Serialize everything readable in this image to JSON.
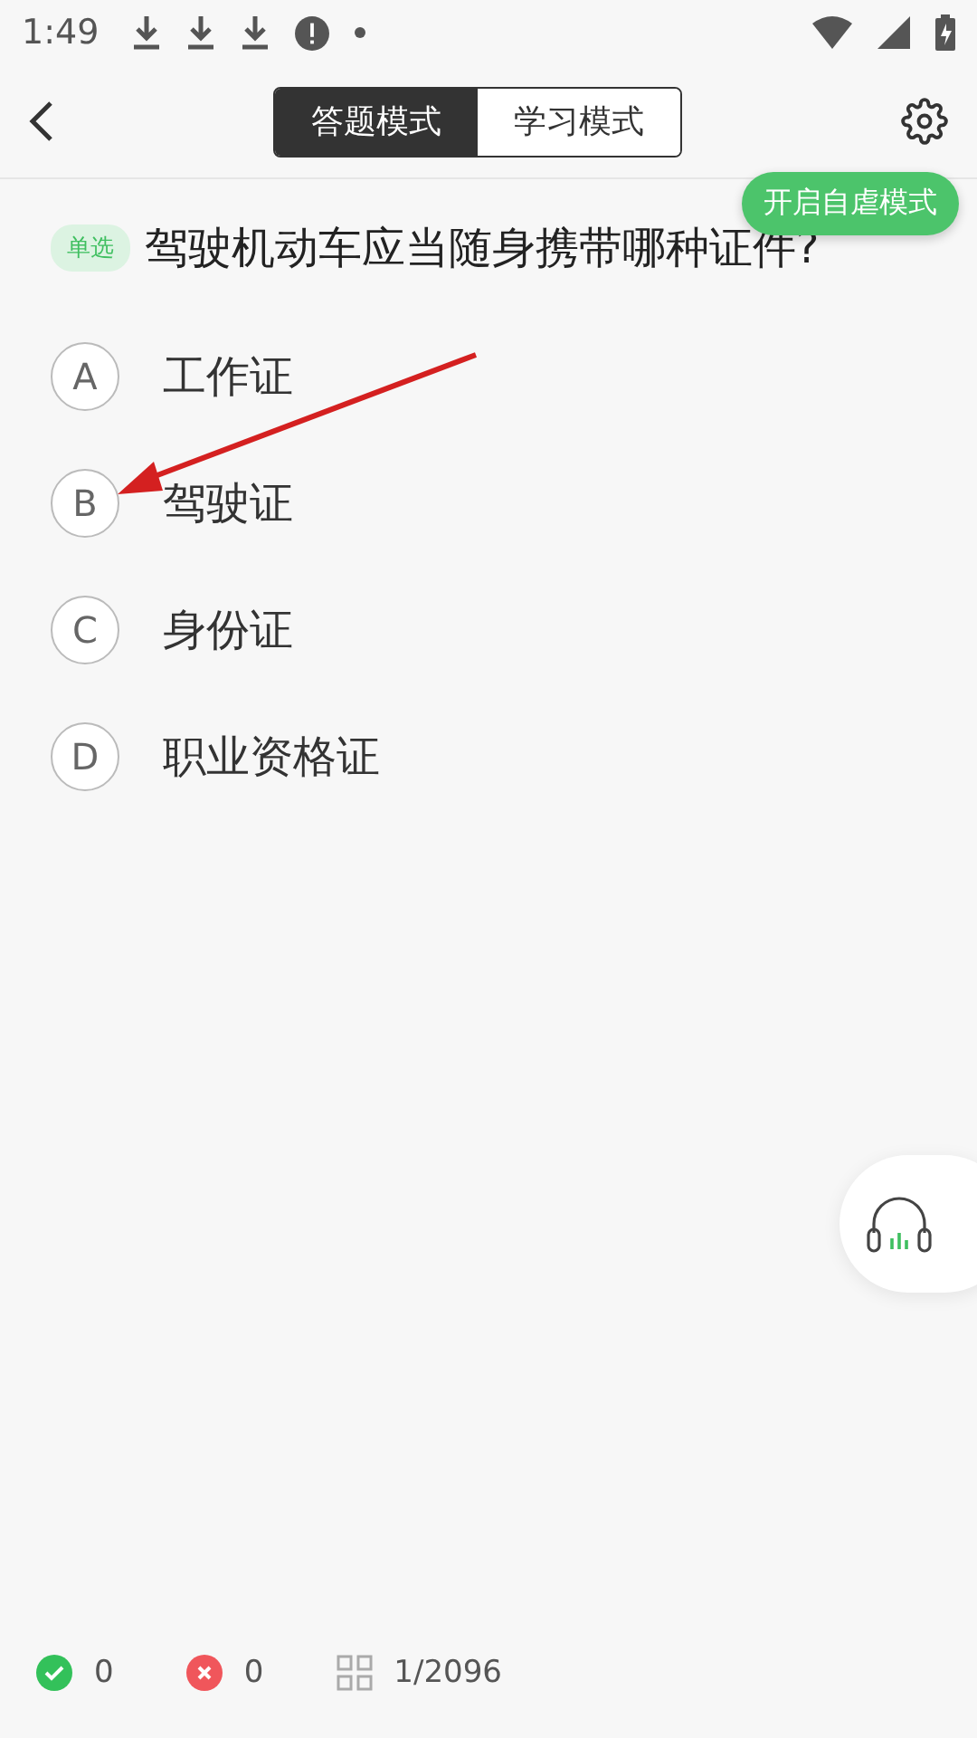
{
  "status_bar": {
    "time": "1:49"
  },
  "mode_tabs": [
    {
      "label": "答题模式",
      "selected": true
    },
    {
      "label": "学习模式",
      "selected": false
    }
  ],
  "tooltip": "开启自虐模式",
  "question": {
    "tag": "单选",
    "text": "驾驶机动车应当随身携带哪种证件?"
  },
  "options": [
    {
      "letter": "A",
      "text": "工作证",
      "selected": false
    },
    {
      "letter": "B",
      "text": "驾驶证",
      "selected": false
    },
    {
      "letter": "C",
      "text": "身份证",
      "selected": false
    },
    {
      "letter": "D",
      "text": "职业资格证",
      "selected": false
    }
  ],
  "footer": {
    "correct": "0",
    "wrong": "0",
    "progress": "1/2096"
  }
}
